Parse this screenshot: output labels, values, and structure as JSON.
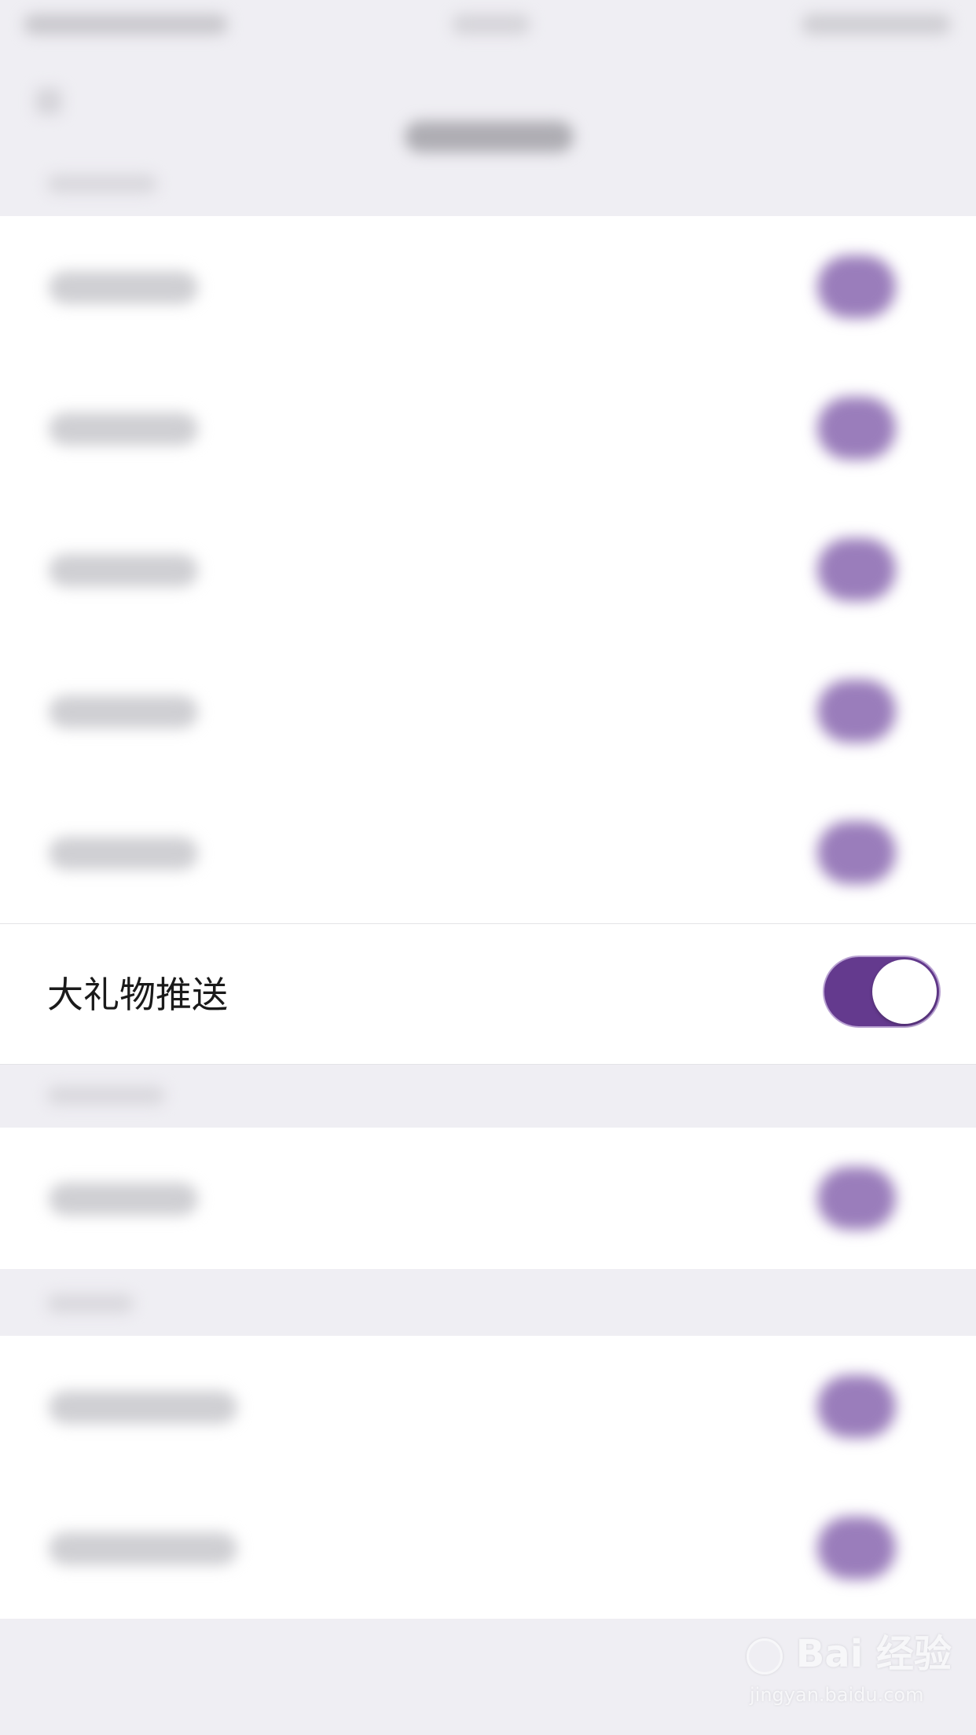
{
  "focused_setting": {
    "label": "大礼物推送",
    "toggle_on": true
  },
  "colors": {
    "accent": "#643a8e",
    "background": "#efeef3",
    "cell_background": "#ffffff"
  },
  "watermark": {
    "brand": "Bai 经验",
    "url": "jingyan.baidu.com"
  }
}
